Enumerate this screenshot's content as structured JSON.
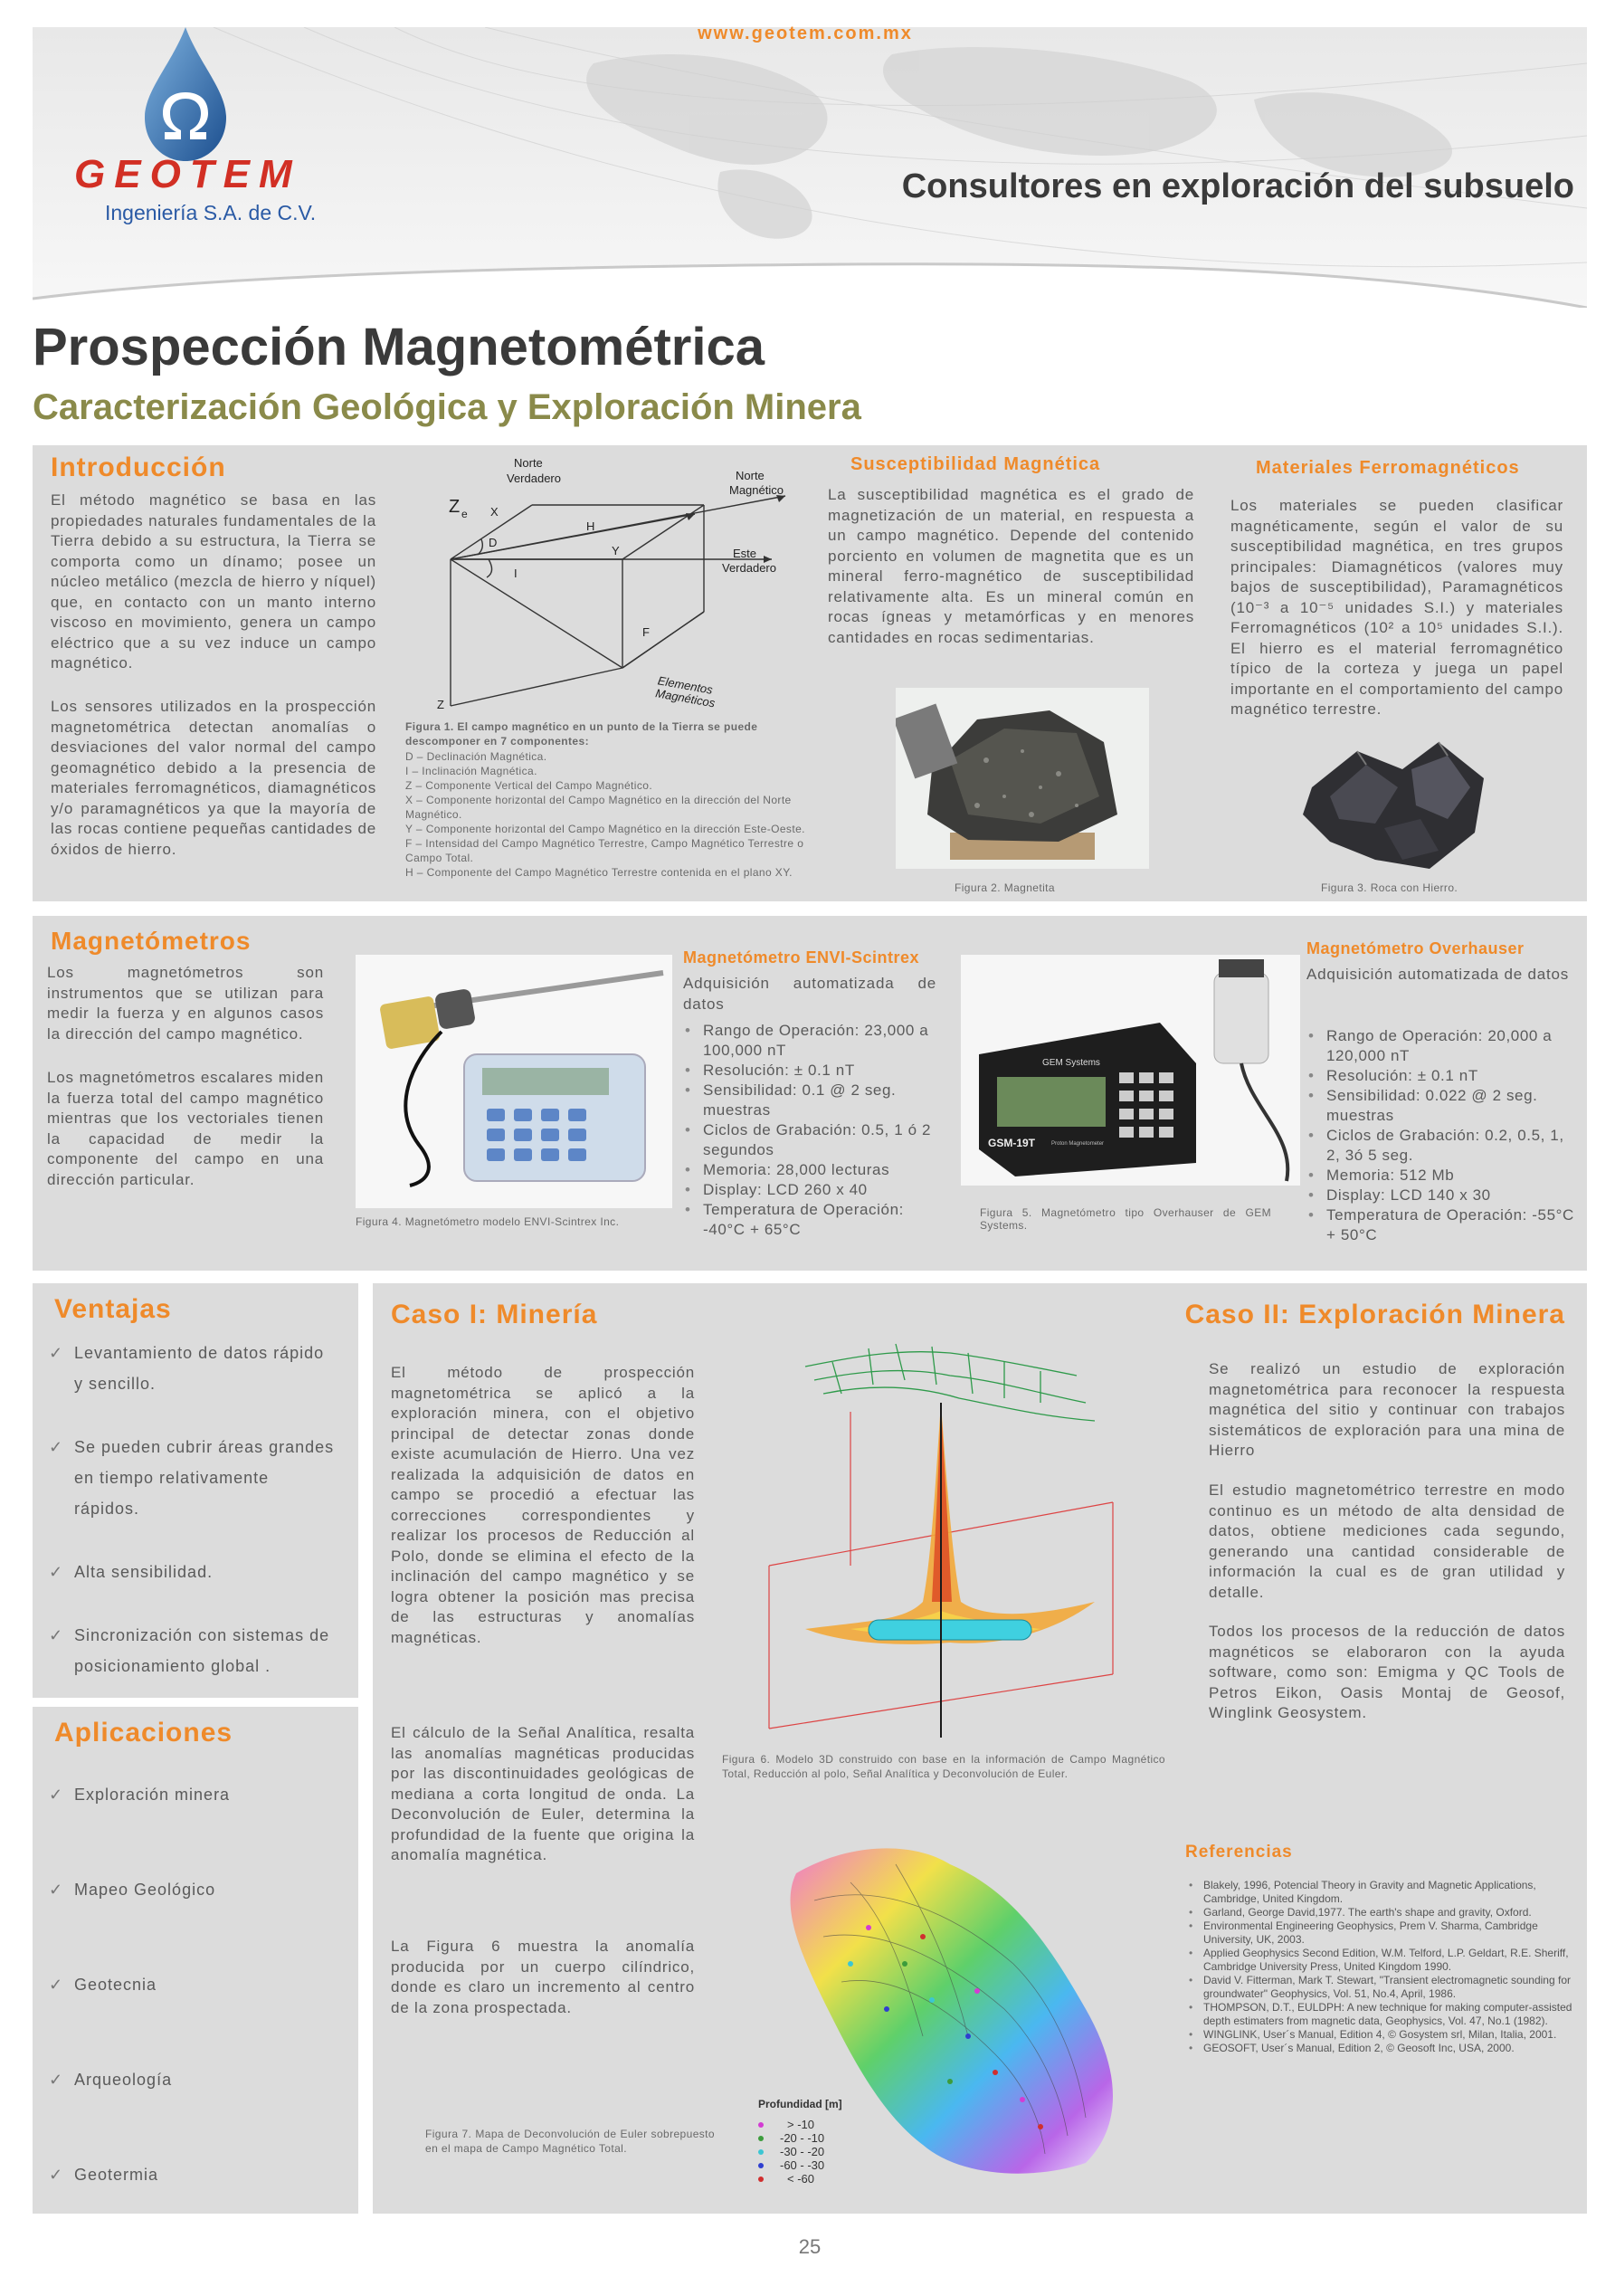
{
  "header": {
    "url": "www.geotem.com.mx",
    "logo_text": "GEOTEM",
    "logo_sub": "Ingeniería S.A. de C.V.",
    "tagline": "Consultores en exploración del subsuelo",
    "brand_red": "#d22f24",
    "brand_orange": "#ef8a2a"
  },
  "title": "Prospección Magnetométrica",
  "subtitle": "Caracterización Geológica y Exploración Minera",
  "intro": {
    "heading": "Introducción",
    "text": "El método magnético se basa en las propiedades naturales fundamentales de la Tierra debido a su estructura, la Tierra se comporta como un dínamo; posee un núcleo metálico (mezcla de hierro y níquel) que, en contacto con un manto interno viscoso en movimiento, genera un campo eléctrico que a su vez induce un campo magnético.",
    "text2": "Los sensores utilizados en la prospección magnetométrica detectan anomalías o desviaciones del valor normal del campo geomagnético debido a la presencia de materiales ferromagnéticos, diamagnéticos y/o paramagnéticos ya que la mayoría de las rocas contiene pequeñas cantidades de óxidos de hierro."
  },
  "figure1": {
    "labels": {
      "north_true": "Norte\nVerdadero",
      "north_mag": "Norte\nMagnético",
      "east_true": "Este\nVerdadero",
      "ze": "Ze",
      "x": "X",
      "h": "H",
      "d": "D",
      "y": "Y",
      "i": "I",
      "f": "F",
      "z": "Z",
      "elements": "Elementos\nMagnéticos"
    },
    "caption_title": "Figura 1. El campo magnético en un punto de la Tierra se puede descomponer en 7 componentes:",
    "caption_lines": [
      "D – Declinación Magnética.",
      "I – Inclinación Magnética.",
      "Z – Componente Vertical del Campo Magnético.",
      "X – Componente horizontal del Campo Magnético en la dirección del Norte Magnético.",
      "Y – Componente horizontal del Campo Magnético en la dirección Este-Oeste.",
      "F – Intensidad del Campo Magnético Terrestre, Campo Magnético Terrestre o Campo Total.",
      "H – Componente del Campo Magnético Terrestre contenida en el plano XY."
    ]
  },
  "susceptibilidad": {
    "heading": "Susceptibilidad Magnética",
    "text": "La susceptibilidad magnética es el grado de magnetización de un material, en respuesta a un campo magnético. Depende del contenido porciento en volumen de magnetita que es un mineral ferro-magnético de susceptibilidad relativamente alta. Es un mineral común en rocas ígneas y metamórficas y en menores cantidades en rocas sedimentarias.",
    "caption": "Figura 2.  Magnetita"
  },
  "ferro": {
    "heading": "Materiales Ferromagnéticos",
    "text": "Los materiales se pueden clasificar magnéticamente, según el valor de su susceptibilidad magnética, en tres grupos principales: Diamagnéticos (valores muy bajos de susceptibilidad), Paramagnéticos (10⁻³ a 10⁻⁵ unidades S.I.) y materiales Ferromagnéticos (10² a 10⁵ unidades S.I.). El hierro es el material ferromagnético típico de la corteza y juega un papel importante en el comportamiento del campo magnético terrestre.",
    "caption": "Figura 3.  Roca con Hierro."
  },
  "magnetometros": {
    "heading": "Magnetómetros",
    "text": "Los magnetómetros son instrumentos que se utilizan para medir la fuerza y en algunos casos la dirección del campo magnético.",
    "text2": "Los magnetómetros escalares miden la fuerza total del campo magnético mientras que los vectoriales tienen la capacidad de medir la componente del campo en una dirección particular.",
    "fig4_caption": "Figura 4. Magnetómetro modelo ENVI-Scintrex Inc."
  },
  "envi": {
    "heading": "Magnetómetro ENVI-Scintrex",
    "intro": "Adquisición automatizada de datos",
    "specs": [
      "Rango de Operación: 23,000 a 100,000 nT",
      "Resolución: ± 0.1 nT",
      "Sensibilidad: 0.1 @ 2 seg. muestras",
      "Ciclos de Grabación: 0.5, 1 ó 2 segundos",
      "Memoria: 28,000 lecturas",
      "Display: LCD 260 x 40",
      "Temperatura de Operación: -40°C + 65°C"
    ]
  },
  "overhauser": {
    "heading": "Magnetómetro Overhauser",
    "intro": "Adquisición automatizada de datos",
    "specs": [
      "Rango de Operación: 20,000 a 120,000 nT",
      "Resolución: ± 0.1 nT",
      "Sensibilidad: 0.022 @ 2 seg. muestras",
      "Ciclos de Grabación: 0.2, 0.5, 1, 2, 3ó 5 seg.",
      "Memoria: 512 Mb",
      "Display: LCD 140 x 30",
      "Temperatura de Operación: -55°C + 50°C"
    ],
    "fig5_caption": "Figura 5. Magnetómetro tipo Overhauser de GEM Systems.",
    "device_brand": "GEM Systems",
    "device_model": "GSM-19T",
    "device_label": "Proton Magnetometer"
  },
  "ventajas": {
    "heading": "Ventajas",
    "items": [
      "Levantamiento de datos rápido y sencillo.",
      "Se pueden cubrir áreas grandes en tiempo relativamente rápidos.",
      "Alta sensibilidad.",
      "Sincronización con sistemas de posicionamiento global ."
    ]
  },
  "aplicaciones": {
    "heading": "Aplicaciones",
    "items": [
      "Exploración minera",
      "Mapeo Geológico",
      "Geotecnia",
      "Arqueología",
      "Geotermia"
    ]
  },
  "caso1": {
    "heading": "Caso I: Minería",
    "p1": "El método de prospección magnetométrica se aplicó a la exploración minera, con el objetivo principal de detectar zonas donde existe acumulación de Hierro. Una vez realizada la adquisición de datos en campo se procedió a efectuar las correcciones correspondientes y realizar los procesos de Reducción al Polo, donde se elimina el efecto de la inclinación del campo magnético y se logra obtener la posición mas precisa de las estructuras y anomalías magnéticas.",
    "p2": "El cálculo de la Señal Analítica, resalta las anomalías magnéticas producidas por las discontinuidades geológicas de mediana a corta longitud de onda. La Deconvolución de Euler, determina la profundidad de la fuente que origina la anomalía magnética.",
    "p3": "La Figura 6 muestra la anomalía producida por un cuerpo cilíndrico, donde es claro un incremento al centro de la zona prospectada.",
    "fig6_caption": "Figura 6. Modelo 3D construido con base en la información de Campo Magnético Total, Reducción al polo, Señal Analítica y Deconvolución de Euler.",
    "fig7_caption": "Figura 7. Mapa de Deconvolución de Euler sobrepuesto en el mapa de Campo Magnético Total.",
    "legend_title": "Profundidad [m]",
    "legend": [
      {
        "label": ">  -10",
        "color": "#d33cd3"
      },
      {
        "label": "-20  -  -10",
        "color": "#3c9c3c"
      },
      {
        "label": "-30  -  -20",
        "color": "#3cc6d3"
      },
      {
        "label": "-60  -  -30",
        "color": "#2f3fd0"
      },
      {
        "label": "<  -60",
        "color": "#d02f2f"
      }
    ]
  },
  "caso2": {
    "heading": "Caso II: Exploración Minera",
    "p1": "Se realizó un estudio de exploración magnetométrica para reconocer la respuesta magnética del sitio y continuar con trabajos sistemáticos de exploración para una mina de Hierro",
    "p2": "El estudio magnetométrico terrestre en modo continuo es un método de alta densidad de datos, obtiene mediciones cada segundo, generando una cantidad considerable de información la cual es de gran utilidad y detalle.",
    "p3": "Todos los procesos de la reducción de datos magnéticos se elaboraron con la ayuda software, como son: Emigma y QC Tools de Petros Eikon, Oasis Montaj de Geosof, Winglink Geosystem."
  },
  "referencias": {
    "heading": "Referencias",
    "items": [
      "Blakely, 1996, Potencial Theory in Gravity and Magnetic Applications, Cambridge, United Kingdom.",
      "Garland, George David,1977. The earth's shape and gravity, Oxford.",
      "Environmental Engineering Geophysics, Prem V. Sharma, Cambridge University, UK, 2003.",
      "Applied Geophysics Second Edition, W.M. Telford, L.P. Geldart, R.E. Sheriff, Cambridge University Press, United Kingdom 1990.",
      "David V. Fitterman, Mark T. Stewart, \"Transient electromagnetic sounding for groundwater\" Geophysics, Vol. 51, No.4, April, 1986.",
      "THOMPSON, D.T., EULDPH: A new technique for making computer-assisted depth estimaters from magnetic data, Geophysics, Vol. 47, No.1 (1982).",
      "WINGLINK, User´s Manual, Edition 4, © Gosystem srl, Milan, Italia, 2001.",
      "GEOSOFT, User´s Manual, Edition 2, © Geosoft Inc, USA, 2000."
    ]
  },
  "page_number": "25"
}
